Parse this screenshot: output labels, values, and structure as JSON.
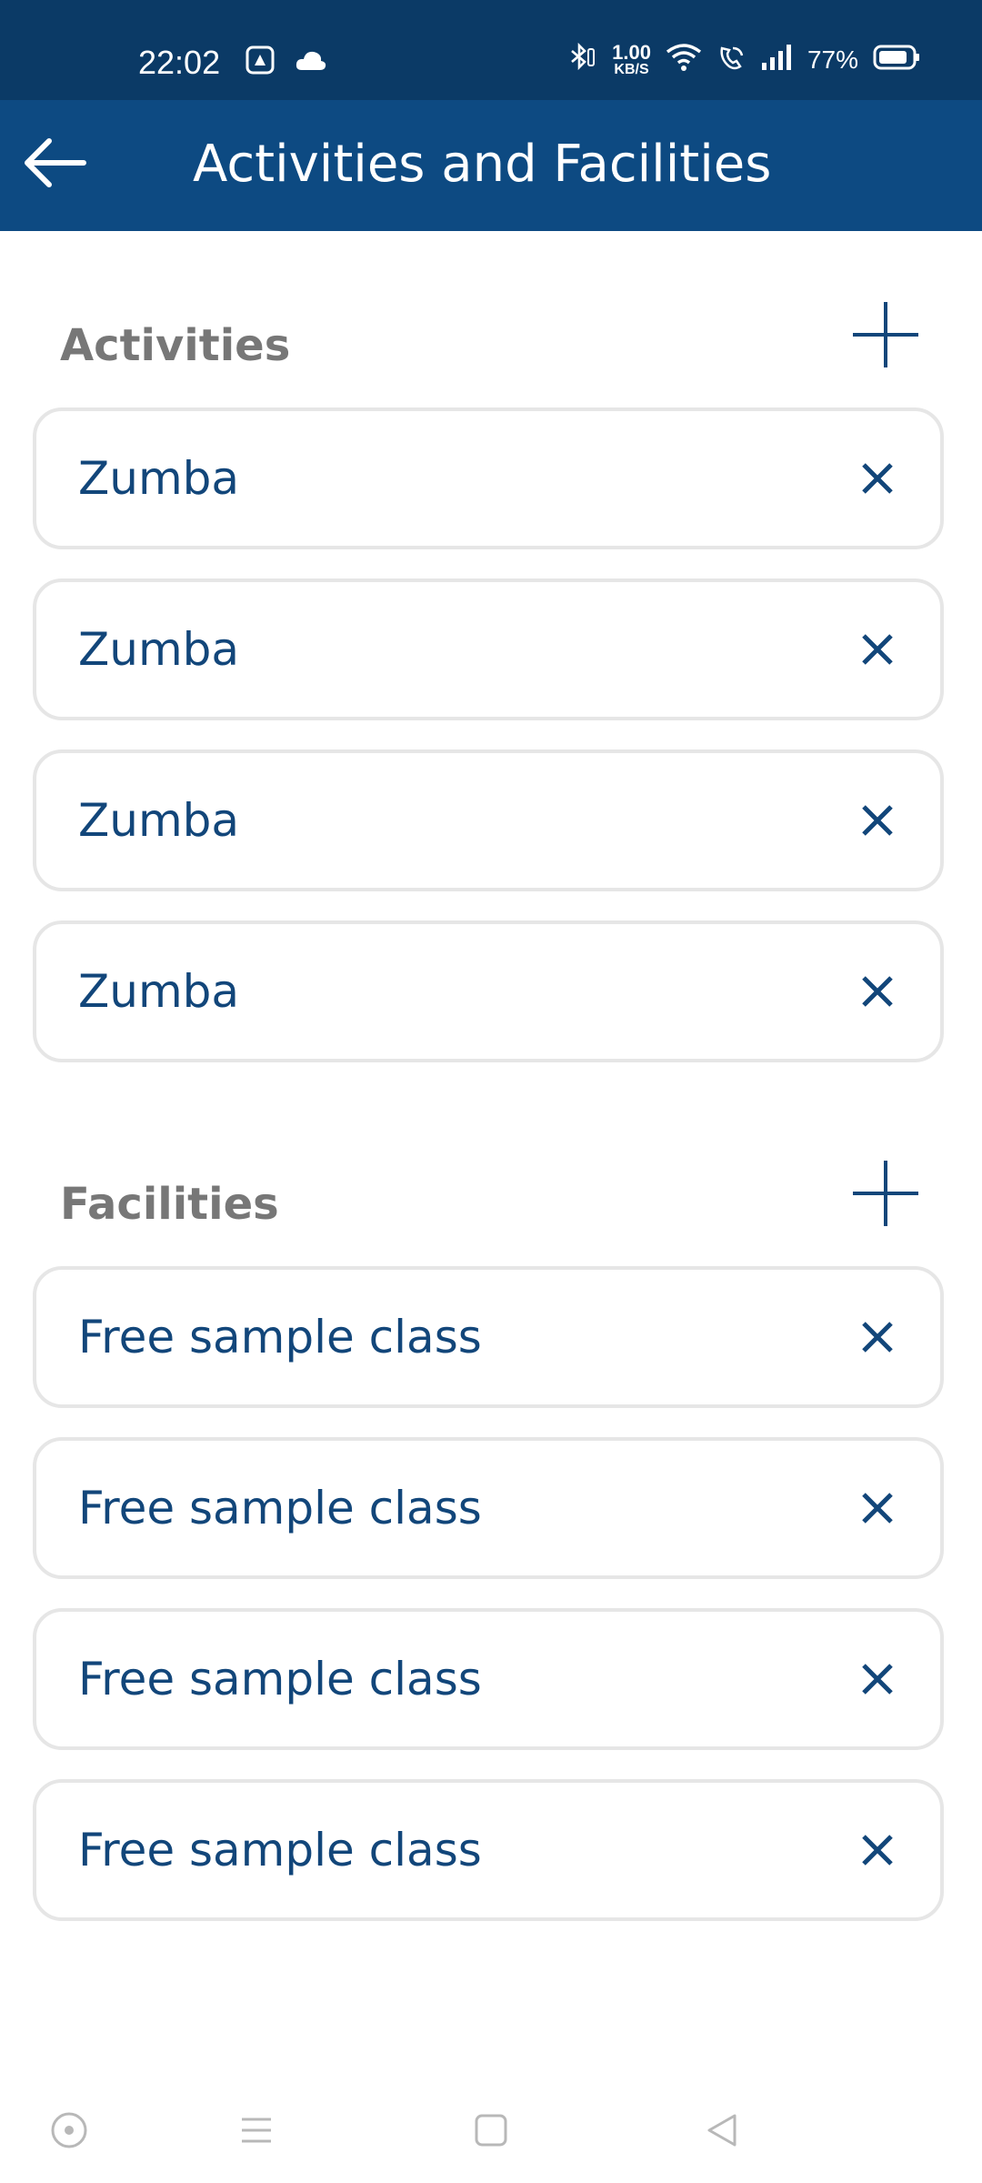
{
  "status_bar": {
    "time": "22:02",
    "net_speed_value": "1.00",
    "net_speed_unit": "KB/S",
    "battery": "77%",
    "icons": [
      "app-icon",
      "cloud-icon",
      "bluetooth-icon",
      "wifi-icon",
      "wifi-call-icon",
      "signal-icon",
      "battery-icon"
    ]
  },
  "app_bar": {
    "title": "Activities and Facilities",
    "back_icon": "back-arrow-icon"
  },
  "colors": {
    "status_bar_bg": "#0b3a66",
    "app_bar_bg": "#0d4a82",
    "item_text": "#12467a",
    "section_title": "#777777",
    "item_border": "#e6e6e6"
  },
  "sections": [
    {
      "title": "Activities",
      "add_icon": "plus-icon",
      "items": [
        {
          "label": "Zumba"
        },
        {
          "label": "Zumba"
        },
        {
          "label": "Zumba"
        },
        {
          "label": "Zumba"
        }
      ]
    },
    {
      "title": "Facilities",
      "add_icon": "plus-icon",
      "items": [
        {
          "label": "Free sample class"
        },
        {
          "label": "Free sample class"
        },
        {
          "label": "Free sample class"
        },
        {
          "label": "Free sample class"
        }
      ]
    }
  ],
  "nav_bar": {
    "items": [
      "assistant-icon",
      "menu-icon",
      "home-icon",
      "back-icon"
    ]
  }
}
